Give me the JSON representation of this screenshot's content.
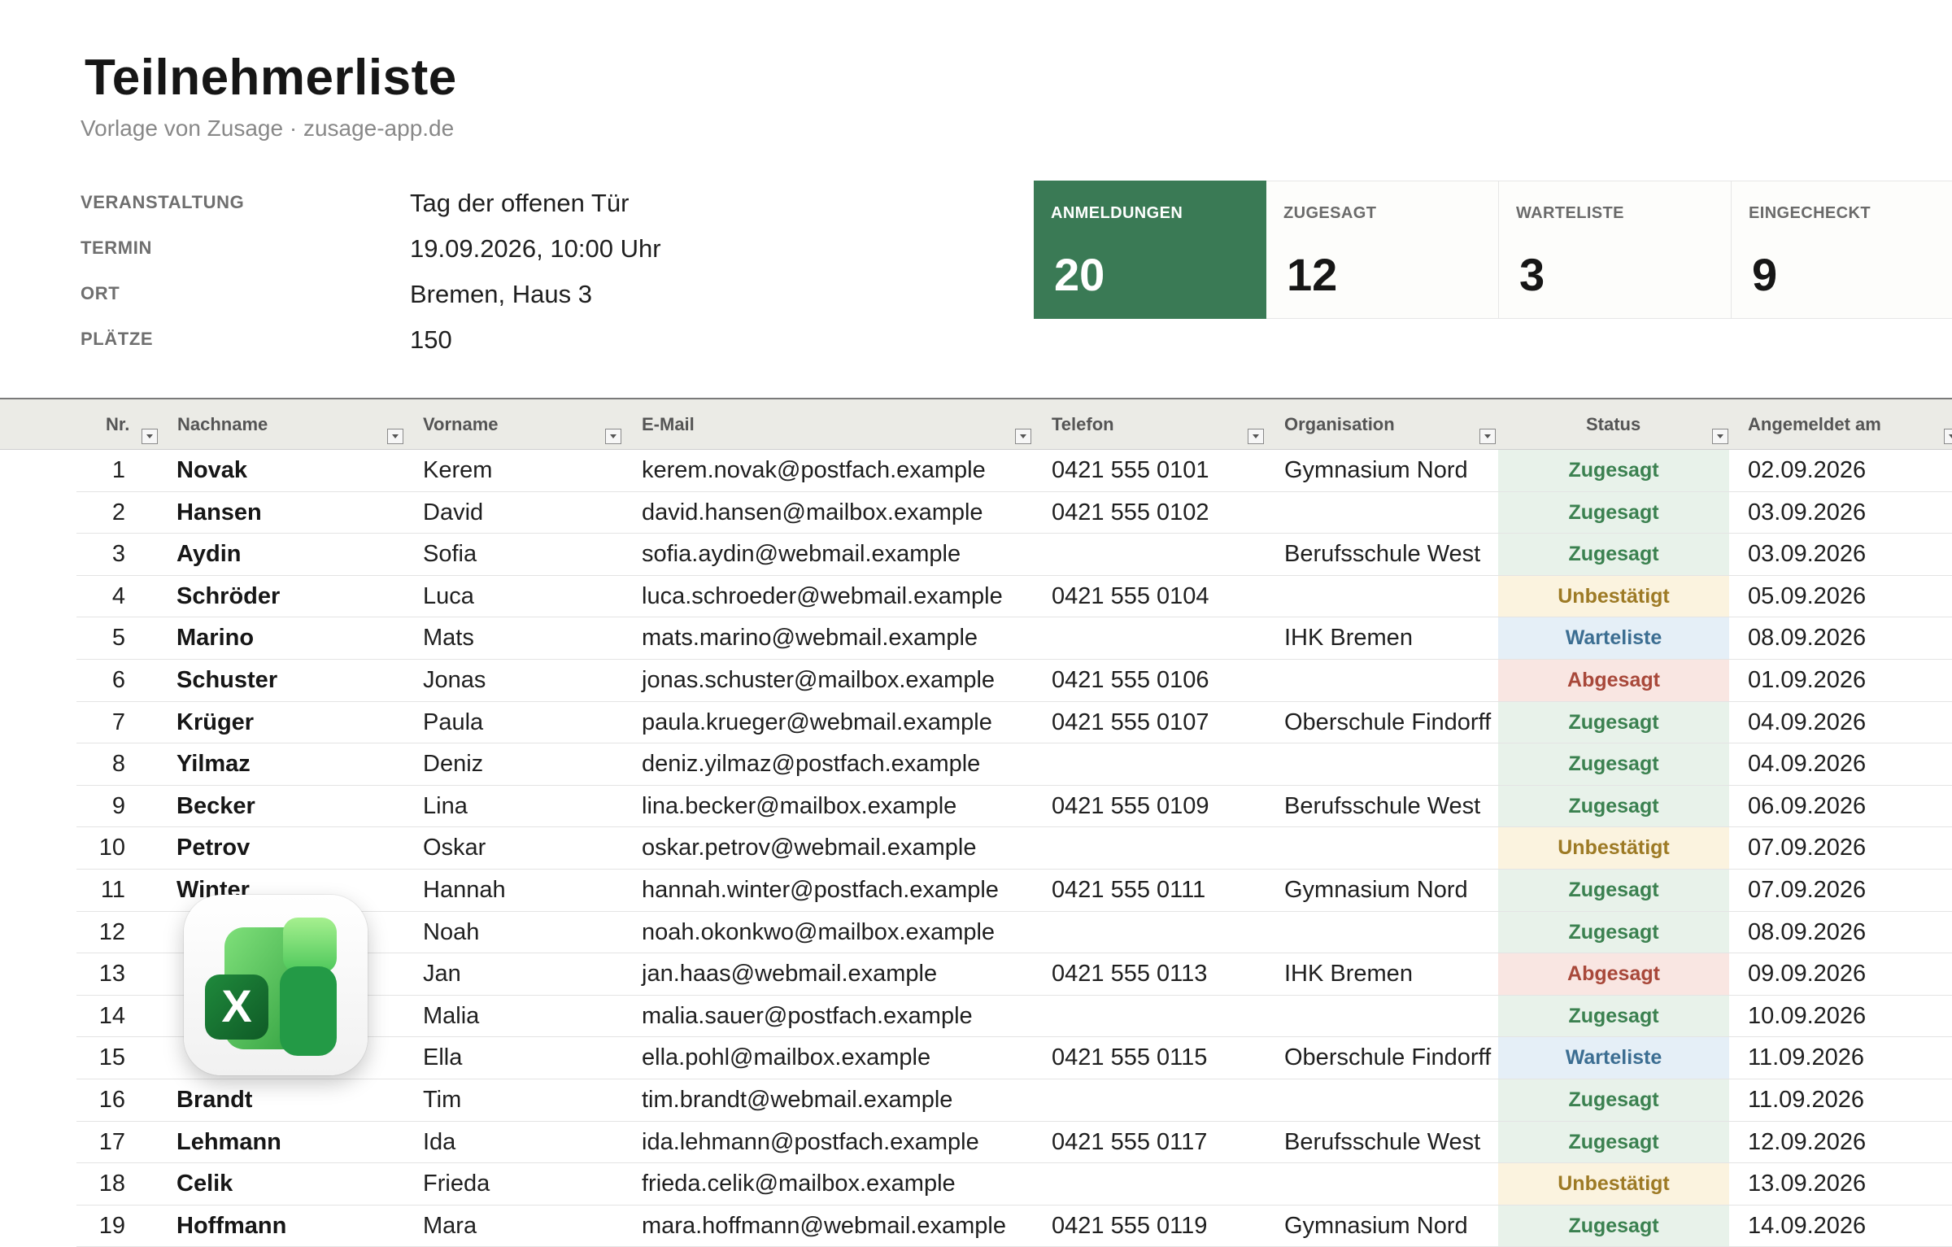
{
  "header": {
    "title": "Teilnehmerliste",
    "subtitle": "Vorlage von Zusage · zusage-app.de"
  },
  "event": [
    {
      "label": "VERANSTALTUNG",
      "value": "Tag der offenen Tür"
    },
    {
      "label": "TERMIN",
      "value": "19.09.2026, 10:00 Uhr"
    },
    {
      "label": "ORT",
      "value": "Bremen, Haus 3"
    },
    {
      "label": "PLÄTZE",
      "value": "150"
    }
  ],
  "stats": [
    {
      "label": "ANMELDUNGEN",
      "value": "20",
      "active": true
    },
    {
      "label": "ZUGESAGT",
      "value": "12"
    },
    {
      "label": "WARTELISTE",
      "value": "3"
    },
    {
      "label": "EINGECHECKT",
      "value": "9"
    }
  ],
  "table": {
    "columns": [
      "Nr.",
      "Nachname",
      "Vorname",
      "E-Mail",
      "Telefon",
      "Organisation",
      "Status",
      "Angemeldet am"
    ],
    "rows": [
      [
        "1",
        "Novak",
        "Kerem",
        "kerem.novak@postfach.example",
        "0421 555 0101",
        "Gymnasium Nord",
        "Zugesagt",
        "02.09.2026"
      ],
      [
        "2",
        "Hansen",
        "David",
        "david.hansen@mailbox.example",
        "0421 555 0102",
        "",
        "Zugesagt",
        "03.09.2026"
      ],
      [
        "3",
        "Aydin",
        "Sofia",
        "sofia.aydin@webmail.example",
        "",
        "Berufsschule West",
        "Zugesagt",
        "03.09.2026"
      ],
      [
        "4",
        "Schröder",
        "Luca",
        "luca.schroeder@webmail.example",
        "0421 555 0104",
        "",
        "Unbestätigt",
        "05.09.2026"
      ],
      [
        "5",
        "Marino",
        "Mats",
        "mats.marino@webmail.example",
        "",
        "IHK Bremen",
        "Warteliste",
        "08.09.2026"
      ],
      [
        "6",
        "Schuster",
        "Jonas",
        "jonas.schuster@mailbox.example",
        "0421 555 0106",
        "",
        "Abgesagt",
        "01.09.2026"
      ],
      [
        "7",
        "Krüger",
        "Paula",
        "paula.krueger@webmail.example",
        "0421 555 0107",
        "Oberschule Findorff",
        "Zugesagt",
        "04.09.2026"
      ],
      [
        "8",
        "Yilmaz",
        "Deniz",
        "deniz.yilmaz@postfach.example",
        "",
        "",
        "Zugesagt",
        "04.09.2026"
      ],
      [
        "9",
        "Becker",
        "Lina",
        "lina.becker@mailbox.example",
        "0421 555 0109",
        "Berufsschule West",
        "Zugesagt",
        "06.09.2026"
      ],
      [
        "10",
        "Petrov",
        "Oskar",
        "oskar.petrov@webmail.example",
        "",
        "",
        "Unbestätigt",
        "07.09.2026"
      ],
      [
        "11",
        "Winter",
        "Hannah",
        "hannah.winter@postfach.example",
        "0421 555 0111",
        "Gymnasium Nord",
        "Zugesagt",
        "07.09.2026"
      ],
      [
        "12",
        "",
        "Noah",
        "noah.okonkwo@mailbox.example",
        "",
        "",
        "Zugesagt",
        "08.09.2026"
      ],
      [
        "13",
        "",
        "Jan",
        "jan.haas@webmail.example",
        "0421 555 0113",
        "IHK Bremen",
        "Abgesagt",
        "09.09.2026"
      ],
      [
        "14",
        "",
        "Malia",
        "malia.sauer@postfach.example",
        "",
        "",
        "Zugesagt",
        "10.09.2026"
      ],
      [
        "15",
        "",
        "Ella",
        "ella.pohl@mailbox.example",
        "0421 555 0115",
        "Oberschule Findorff",
        "Warteliste",
        "11.09.2026"
      ],
      [
        "16",
        "Brandt",
        "Tim",
        "tim.brandt@webmail.example",
        "",
        "",
        "Zugesagt",
        "11.09.2026"
      ],
      [
        "17",
        "Lehmann",
        "Ida",
        "ida.lehmann@postfach.example",
        "0421 555 0117",
        "Berufsschule West",
        "Zugesagt",
        "12.09.2026"
      ],
      [
        "18",
        "Celik",
        "Frieda",
        "frieda.celik@mailbox.example",
        "",
        "",
        "Unbestätigt",
        "13.09.2026"
      ],
      [
        "19",
        "Hoffmann",
        "Mara",
        "mara.hoffmann@webmail.example",
        "0421 555 0119",
        "Gymnasium Nord",
        "Zugesagt",
        "14.09.2026"
      ]
    ]
  },
  "status_colors": {
    "Zugesagt": "#3b8150",
    "Unbestätigt": "#9d7a25",
    "Warteliste": "#3c6e92",
    "Abgesagt": "#a8483a"
  },
  "accent": "#3a7a55",
  "overlay_icon": {
    "name": "excel-app-icon",
    "letter": "X"
  }
}
